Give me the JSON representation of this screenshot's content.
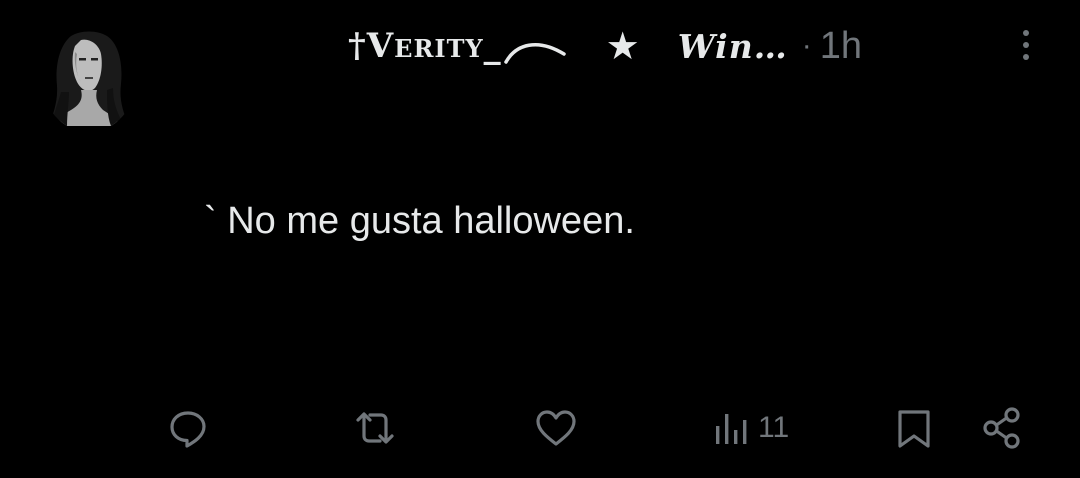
{
  "post": {
    "author": {
      "display_name": "†Verity_",
      "badge_icon": "star-icon",
      "badge": "★",
      "handle": "Win…",
      "separator": "·",
      "timestamp": "1h"
    },
    "text": "` No me gusta halloween.",
    "actions": {
      "reply_icon": "reply-icon",
      "repost_icon": "repost-icon",
      "like_icon": "like-icon",
      "views_icon": "views-icon",
      "views_count": "11",
      "bookmark_icon": "bookmark-icon",
      "share_icon": "share-icon"
    },
    "menu_icon": "more-options-icon"
  },
  "colors": {
    "background": "#000000",
    "text_primary": "#e7e9ea",
    "text_secondary": "#71767b"
  }
}
